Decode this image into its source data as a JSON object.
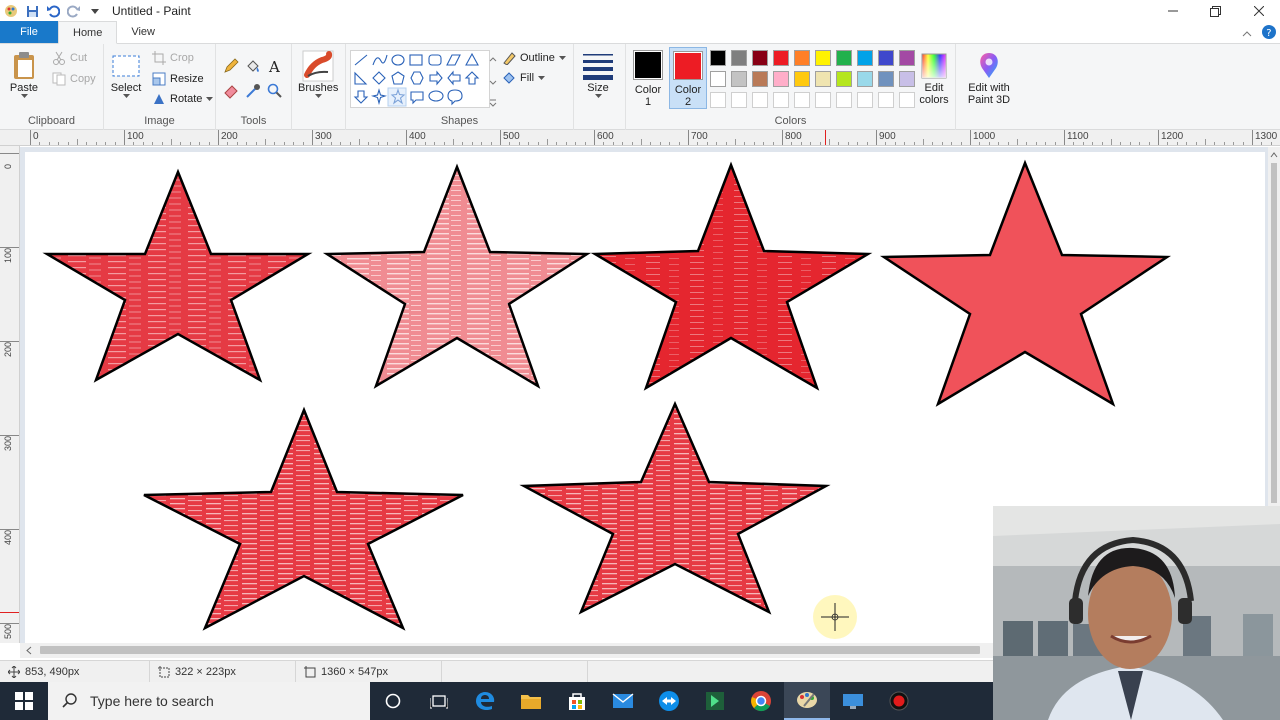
{
  "window": {
    "title": "Untitled - Paint",
    "controls": [
      "minimize",
      "restore",
      "close"
    ]
  },
  "tabs": {
    "file": "File",
    "home": "Home",
    "view": "View"
  },
  "ribbon": {
    "clipboard": {
      "paste": "Paste",
      "cut": "Cut",
      "copy": "Copy",
      "label": "Clipboard"
    },
    "image": {
      "select": "Select",
      "crop": "Crop",
      "resize": "Resize",
      "rotate": "Rotate",
      "label": "Image"
    },
    "tools": {
      "label": "Tools",
      "items": [
        "pencil-icon",
        "fill-icon",
        "text-icon",
        "eraser-icon",
        "color-picker-icon",
        "magnifier-icon"
      ]
    },
    "brushes": {
      "label": "Brushes"
    },
    "shapes": {
      "label": "Shapes",
      "outline": "Outline",
      "fill": "Fill"
    },
    "size": {
      "label": "Size"
    },
    "colors": {
      "label": "Colors",
      "color1_label": "Color",
      "color1_num": "1",
      "color2_label": "Color",
      "color2_num": "2",
      "color1_value": "#000000",
      "color2_value": "#ed1c24",
      "palette_row1": [
        "#000000",
        "#7f7f7f",
        "#880015",
        "#ed1c24",
        "#ff7f27",
        "#fff200",
        "#22b14c",
        "#00a2e8",
        "#3f48cc",
        "#a349a4"
      ],
      "palette_row2": [
        "#ffffff",
        "#c3c3c3",
        "#b97a57",
        "#ffaec9",
        "#ffc90e",
        "#efe4b0",
        "#b5e61d",
        "#99d9ea",
        "#7092be",
        "#c8bfe7"
      ],
      "edit_colors": "Edit colors",
      "edit_colors_l1": "Edit",
      "edit_colors_l2": "colors",
      "edit_3d_l1": "Edit with",
      "edit_3d_l2": "Paint 3D"
    }
  },
  "ruler": {
    "h_labels": [
      "0",
      "100",
      "200",
      "300",
      "400",
      "500",
      "600",
      "700",
      "800",
      "900",
      "1000",
      "1100",
      "1200",
      "1300"
    ],
    "v_labels": [
      "0",
      "100",
      "200",
      "300",
      "400",
      "500"
    ]
  },
  "canvas": {
    "star_color": "#e8454b",
    "outline_color": "#000000"
  },
  "statusbar": {
    "cursor_pos": "853, 490px",
    "selection_size": "322 × 223px",
    "image_size": "1360 × 547px"
  },
  "taskbar": {
    "search_placeholder": "Type here to search",
    "icons": [
      "start-icon",
      "cortana-icon",
      "task-view-icon",
      "edge-icon",
      "file-explorer-icon",
      "store-icon",
      "mail-icon",
      "teamviewer-icon",
      "app-icon",
      "chrome-icon",
      "paint-icon",
      "remote-icon",
      "record-icon"
    ]
  }
}
